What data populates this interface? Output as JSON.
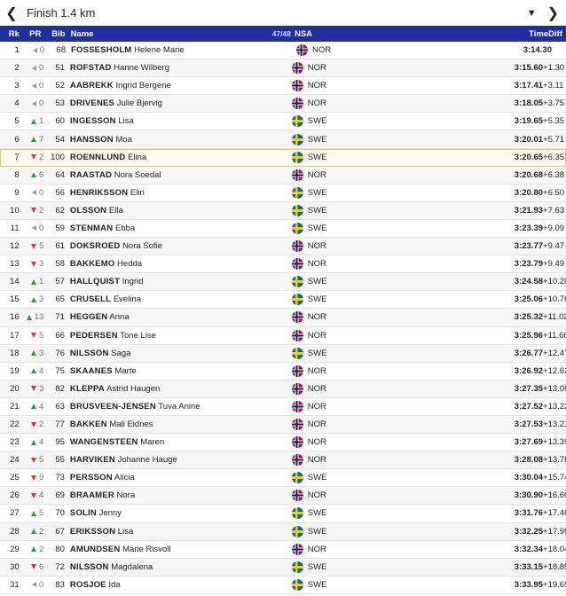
{
  "header": {
    "title": "Finish 1.4 km",
    "prev_icon": "chevron-left-icon",
    "dropdown_icon": "caret-down-icon",
    "next_icon": "chevron-right-icon"
  },
  "columns": {
    "rk": "Rk",
    "pr": "PR",
    "bib": "Bib",
    "name": "Name",
    "count": "47/48",
    "nsa": "NSA",
    "time": "Time",
    "diff": "Diff"
  },
  "colors": {
    "header_bg": "#1f2fa0",
    "up": "#2e9c3f",
    "down": "#d93838",
    "highlight_border": "#e9c46a"
  },
  "rows": [
    {
      "rk": "1",
      "pr_dir": "same",
      "pr": "0",
      "bib": "68",
      "last": "FOSSESHOLM",
      "first": "Helene Marie",
      "nsa": "NOR",
      "time": "3:14.30",
      "diff": ""
    },
    {
      "rk": "2",
      "pr_dir": "same",
      "pr": "0",
      "bib": "51",
      "last": "ROFSTAD",
      "first": "Hanne Wilberg",
      "nsa": "NOR",
      "time": "3:15.60",
      "diff": "+1.30"
    },
    {
      "rk": "3",
      "pr_dir": "same",
      "pr": "0",
      "bib": "52",
      "last": "AABREKK",
      "first": "Ingrid Bergene",
      "nsa": "NOR",
      "time": "3:17.41",
      "diff": "+3.11"
    },
    {
      "rk": "4",
      "pr_dir": "same",
      "pr": "0",
      "bib": "53",
      "last": "DRIVENES",
      "first": "Julie Bjervig",
      "nsa": "NOR",
      "time": "3:18.05",
      "diff": "+3.75"
    },
    {
      "rk": "5",
      "pr_dir": "up",
      "pr": "1",
      "bib": "60",
      "last": "INGESSON",
      "first": "Lisa",
      "nsa": "SWE",
      "time": "3:19.65",
      "diff": "+5.35"
    },
    {
      "rk": "6",
      "pr_dir": "up",
      "pr": "7",
      "bib": "54",
      "last": "HANSSON",
      "first": "Moa",
      "nsa": "SWE",
      "time": "3:20.01",
      "diff": "+5.71"
    },
    {
      "rk": "7",
      "pr_dir": "down",
      "pr": "2",
      "bib": "100",
      "last": "ROENNLUND",
      "first": "Elina",
      "nsa": "SWE",
      "time": "3:20.65",
      "diff": "+6.35",
      "highlight": true
    },
    {
      "rk": "8",
      "pr_dir": "up",
      "pr": "6",
      "bib": "64",
      "last": "RAASTAD",
      "first": "Nora Soedal",
      "nsa": "NOR",
      "time": "3:20.68",
      "diff": "+6.38"
    },
    {
      "rk": "9",
      "pr_dir": "same",
      "pr": "0",
      "bib": "56",
      "last": "HENRIKSSON",
      "first": "Elin",
      "nsa": "SWE",
      "time": "3:20.80",
      "diff": "+6.50"
    },
    {
      "rk": "10",
      "pr_dir": "down",
      "pr": "2",
      "bib": "62",
      "last": "OLSSON",
      "first": "Ella",
      "nsa": "SWE",
      "time": "3:21.93",
      "diff": "+7.63"
    },
    {
      "rk": "11",
      "pr_dir": "same",
      "pr": "0",
      "bib": "59",
      "last": "STENMAN",
      "first": "Ebba",
      "nsa": "SWE",
      "time": "3:23.39",
      "diff": "+9.09"
    },
    {
      "rk": "12",
      "pr_dir": "down",
      "pr": "5",
      "bib": "61",
      "last": "DOKSROED",
      "first": "Nora Sofie",
      "nsa": "NOR",
      "time": "3:23.77",
      "diff": "+9.47"
    },
    {
      "rk": "13",
      "pr_dir": "down",
      "pr": "3",
      "bib": "58",
      "last": "BAKKEMO",
      "first": "Hedda",
      "nsa": "NOR",
      "time": "3:23.79",
      "diff": "+9.49"
    },
    {
      "rk": "14",
      "pr_dir": "up",
      "pr": "1",
      "bib": "57",
      "last": "HALLQUIST",
      "first": "Ingrid",
      "nsa": "SWE",
      "time": "3:24.58",
      "diff": "+10.28"
    },
    {
      "rk": "15",
      "pr_dir": "up",
      "pr": "3",
      "bib": "65",
      "last": "CRUSELL",
      "first": "Evelina",
      "nsa": "SWE",
      "time": "3:25.06",
      "diff": "+10.76"
    },
    {
      "rk": "16",
      "pr_dir": "up",
      "pr": "13",
      "bib": "71",
      "last": "HEGGEN",
      "first": "Anna",
      "nsa": "NOR",
      "time": "3:25.32",
      "diff": "+11.02"
    },
    {
      "rk": "17",
      "pr_dir": "down",
      "pr": "5",
      "bib": "66",
      "last": "PEDERSEN",
      "first": "Tone Lise",
      "nsa": "NOR",
      "time": "3:25.96",
      "diff": "+11.66"
    },
    {
      "rk": "18",
      "pr_dir": "up",
      "pr": "3",
      "bib": "76",
      "last": "NILSSON",
      "first": "Saga",
      "nsa": "SWE",
      "time": "3:26.77",
      "diff": "+12.47"
    },
    {
      "rk": "19",
      "pr_dir": "up",
      "pr": "4",
      "bib": "75",
      "last": "SKAANES",
      "first": "Marte",
      "nsa": "NOR",
      "time": "3:26.92",
      "diff": "+12.62"
    },
    {
      "rk": "20",
      "pr_dir": "down",
      "pr": "3",
      "bib": "82",
      "last": "KLEPPA",
      "first": "Astrid Haugen",
      "nsa": "NOR",
      "time": "3:27.35",
      "diff": "+13.05"
    },
    {
      "rk": "21",
      "pr_dir": "up",
      "pr": "4",
      "bib": "63",
      "last": "BRUSVEEN-JENSEN",
      "first": "Tuva Anine",
      "nsa": "NOR",
      "time": "3:27.52",
      "diff": "+13.22"
    },
    {
      "rk": "22",
      "pr_dir": "down",
      "pr": "2",
      "bib": "77",
      "last": "BAKKEN",
      "first": "Mali Eidnes",
      "nsa": "NOR",
      "time": "3:27.53",
      "diff": "+13.23"
    },
    {
      "rk": "23",
      "pr_dir": "up",
      "pr": "4",
      "bib": "95",
      "last": "WANGENSTEEN",
      "first": "Maren",
      "nsa": "NOR",
      "time": "3:27.69",
      "diff": "+13.39"
    },
    {
      "rk": "24",
      "pr_dir": "down",
      "pr": "5",
      "bib": "55",
      "last": "HARVIKEN",
      "first": "Johanne Hauge",
      "nsa": "NOR",
      "time": "3:28.08",
      "diff": "+13.78"
    },
    {
      "rk": "25",
      "pr_dir": "down",
      "pr": "9",
      "bib": "73",
      "last": "PERSSON",
      "first": "Alicia",
      "nsa": "SWE",
      "time": "3:30.04",
      "diff": "+15.74"
    },
    {
      "rk": "26",
      "pr_dir": "down",
      "pr": "4",
      "bib": "69",
      "last": "BRAAMER",
      "first": "Nora",
      "nsa": "NOR",
      "time": "3:30.90",
      "diff": "+16.60"
    },
    {
      "rk": "27",
      "pr_dir": "up",
      "pr": "5",
      "bib": "70",
      "last": "SOLIN",
      "first": "Jenny",
      "nsa": "SWE",
      "time": "3:31.76",
      "diff": "+17.46"
    },
    {
      "rk": "28",
      "pr_dir": "up",
      "pr": "2",
      "bib": "67",
      "last": "ERIKSSON",
      "first": "Lisa",
      "nsa": "SWE",
      "time": "3:32.25",
      "diff": "+17.95"
    },
    {
      "rk": "29",
      "pr_dir": "up",
      "pr": "2",
      "bib": "80",
      "last": "AMUNDSEN",
      "first": "Marie Risvoll",
      "nsa": "NOR",
      "time": "3:32.34",
      "diff": "+18.04"
    },
    {
      "rk": "30",
      "pr_dir": "down",
      "pr": "6",
      "bib": "72",
      "last": "NILSSON",
      "first": "Magdalena",
      "nsa": "SWE",
      "time": "3:33.15",
      "diff": "+18.85"
    },
    {
      "rk": "31",
      "pr_dir": "same",
      "pr": "0",
      "bib": "83",
      "last": "ROSJOE",
      "first": "Ida",
      "nsa": "SWE",
      "time": "3:33.95",
      "diff": "+19.65"
    }
  ]
}
